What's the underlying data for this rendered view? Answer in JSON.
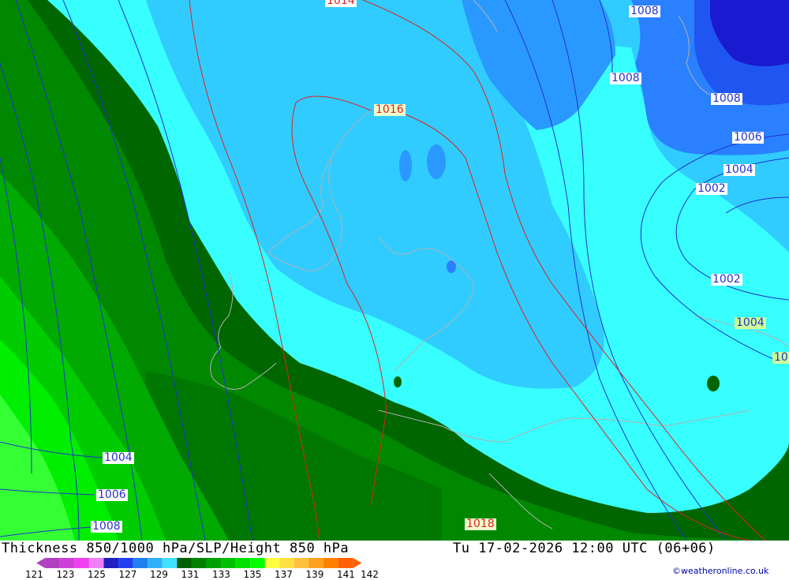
{
  "map": {
    "contour_labels": [
      {
        "text": "1014",
        "kind": "hgt"
      },
      {
        "text": "1008",
        "kind": "slp"
      },
      {
        "text": "1016",
        "kind": "hgtbg"
      },
      {
        "text": "1008",
        "kind": "slp"
      },
      {
        "text": "1008",
        "kind": "slp"
      },
      {
        "text": "1006",
        "kind": "slp"
      },
      {
        "text": "1004",
        "kind": "slp"
      },
      {
        "text": "1002",
        "kind": "slp"
      },
      {
        "text": "1002",
        "kind": "slp"
      },
      {
        "text": "1004",
        "kind": "thk"
      },
      {
        "text": "10",
        "kind": "thk"
      },
      {
        "text": "1004",
        "kind": "slp"
      },
      {
        "text": "1006",
        "kind": "slp"
      },
      {
        "text": "1008",
        "kind": "slp"
      },
      {
        "text": "1018",
        "kind": "hgtbg"
      }
    ]
  },
  "footer": {
    "title": "Thickness 850/1000 hPa/SLP/Height 850 hPa",
    "timestamp": "Tu 17-02-2026 12:00 UTC (06+06)",
    "credit": "©weatheronline.co.uk"
  },
  "legend": {
    "ticks": [
      "121",
      "123",
      "125",
      "127",
      "129",
      "131",
      "133",
      "135",
      "137",
      "139",
      "141",
      "142"
    ],
    "colors": [
      "#b040c0",
      "#d040d8",
      "#f040f0",
      "#f080f8",
      "#2020c0",
      "#2040f0",
      "#2080f0",
      "#30b0f8",
      "#40e0ff",
      "#006000",
      "#008000",
      "#00a000",
      "#00c000",
      "#00e000",
      "#00ff00",
      "#ffff40",
      "#ffe040",
      "#ffc040",
      "#ffa020",
      "#ff8000",
      "#ff6000"
    ]
  },
  "colors": {
    "slp_isobar": "#2233cc",
    "height_contour": "#dd2222",
    "coastline": "#b0b0b0"
  }
}
